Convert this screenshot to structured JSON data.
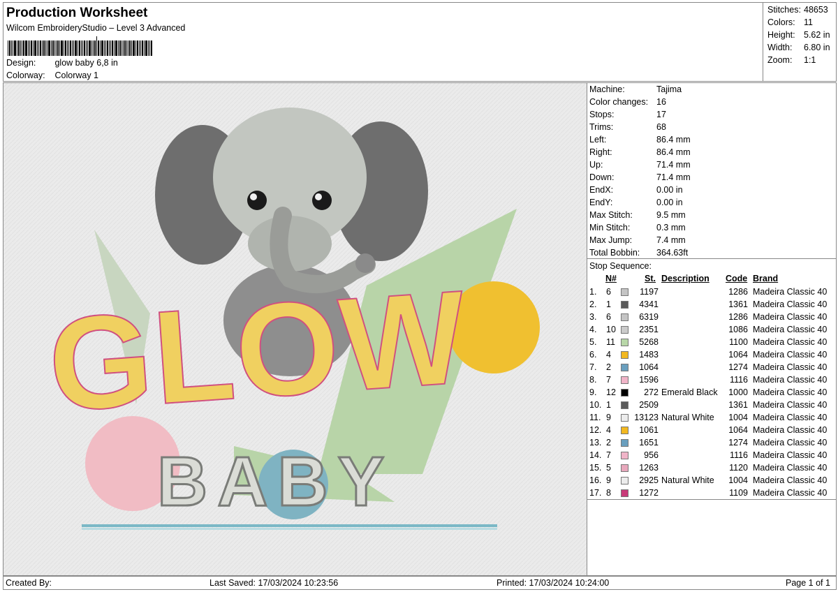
{
  "header": {
    "title": "Production Worksheet",
    "software": "Wilcom EmbroideryStudio – Level 3 Advanced",
    "design_label": "Design:",
    "design_value": "glow baby 6,8 in",
    "colorway_label": "Colorway:",
    "colorway_value": "Colorway 1"
  },
  "stats": {
    "stitches_label": "Stitches:",
    "stitches": "48653",
    "colors_label": "Colors:",
    "colors": "11",
    "height_label": "Height:",
    "height": "5.62 in",
    "width_label": "Width:",
    "width": "6.80 in",
    "zoom_label": "Zoom:",
    "zoom": "1:1"
  },
  "design": {
    "word1": "GLOW",
    "word2": "BABY"
  },
  "machine": [
    {
      "k": "Machine:",
      "v": "Tajima"
    },
    {
      "k": "Color changes:",
      "v": "16"
    },
    {
      "k": "Stops:",
      "v": "17"
    },
    {
      "k": "Trims:",
      "v": "68"
    },
    {
      "k": "Left:",
      "v": "86.4 mm"
    },
    {
      "k": "Right:",
      "v": "86.4 mm"
    },
    {
      "k": "Up:",
      "v": "71.4 mm"
    },
    {
      "k": "Down:",
      "v": "71.4 mm"
    },
    {
      "k": "EndX:",
      "v": "0.00 in"
    },
    {
      "k": "EndY:",
      "v": "0.00 in"
    },
    {
      "k": "Max Stitch:",
      "v": "9.5 mm"
    },
    {
      "k": "Min Stitch:",
      "v": "0.3 mm"
    },
    {
      "k": "Max Jump:",
      "v": "7.4 mm"
    },
    {
      "k": "Total Bobbin:",
      "v": "364.63ft"
    }
  ],
  "sequence": {
    "title": "Stop Sequence:",
    "headers": {
      "n": "N#",
      "st": "St.",
      "desc": "Description",
      "code": "Code",
      "brand": "Brand"
    },
    "rows": [
      {
        "idx": "1.",
        "n": "6",
        "color": "#c4c4c4",
        "st": "1197",
        "desc": "",
        "code": "1286",
        "brand": "Madeira Classic 40"
      },
      {
        "idx": "2.",
        "n": "1",
        "color": "#5a5a5a",
        "st": "4341",
        "desc": "",
        "code": "1361",
        "brand": "Madeira Classic 40"
      },
      {
        "idx": "3.",
        "n": "6",
        "color": "#c4c4c4",
        "st": "6319",
        "desc": "",
        "code": "1286",
        "brand": "Madeira Classic 40"
      },
      {
        "idx": "4.",
        "n": "10",
        "color": "#cbcbcb",
        "st": "2351",
        "desc": "",
        "code": "1086",
        "brand": "Madeira Classic 40"
      },
      {
        "idx": "5.",
        "n": "11",
        "color": "#b8d7a8",
        "st": "5268",
        "desc": "",
        "code": "1100",
        "brand": "Madeira Classic 40"
      },
      {
        "idx": "6.",
        "n": "4",
        "color": "#f2b820",
        "st": "1483",
        "desc": "",
        "code": "1064",
        "brand": "Madeira Classic 40"
      },
      {
        "idx": "7.",
        "n": "2",
        "color": "#6a9fbe",
        "st": "1064",
        "desc": "",
        "code": "1274",
        "brand": "Madeira Classic 40"
      },
      {
        "idx": "8.",
        "n": "7",
        "color": "#f0b4c8",
        "st": "1596",
        "desc": "",
        "code": "1116",
        "brand": "Madeira Classic 40"
      },
      {
        "idx": "9.",
        "n": "12",
        "color": "#000000",
        "st": "272",
        "desc": "Emerald Black",
        "code": "1000",
        "brand": "Madeira Classic 40"
      },
      {
        "idx": "10.",
        "n": "1",
        "color": "#5a5a5a",
        "st": "2509",
        "desc": "",
        "code": "1361",
        "brand": "Madeira Classic 40"
      },
      {
        "idx": "11.",
        "n": "9",
        "color": "#ececec",
        "st": "13123",
        "desc": "Natural White",
        "code": "1004",
        "brand": "Madeira Classic 40"
      },
      {
        "idx": "12.",
        "n": "4",
        "color": "#f2b820",
        "st": "1061",
        "desc": "",
        "code": "1064",
        "brand": "Madeira Classic 40"
      },
      {
        "idx": "13.",
        "n": "2",
        "color": "#6a9fbe",
        "st": "1651",
        "desc": "",
        "code": "1274",
        "brand": "Madeira Classic 40"
      },
      {
        "idx": "14.",
        "n": "7",
        "color": "#f0b4c8",
        "st": "956",
        "desc": "",
        "code": "1116",
        "brand": "Madeira Classic 40"
      },
      {
        "idx": "15.",
        "n": "5",
        "color": "#e8a8bc",
        "st": "1263",
        "desc": "",
        "code": "1120",
        "brand": "Madeira Classic 40"
      },
      {
        "idx": "16.",
        "n": "9",
        "color": "#ececec",
        "st": "2925",
        "desc": "Natural White",
        "code": "1004",
        "brand": "Madeira Classic 40"
      },
      {
        "idx": "17.",
        "n": "8",
        "color": "#c83a78",
        "st": "1272",
        "desc": "",
        "code": "1109",
        "brand": "Madeira Classic 40"
      }
    ]
  },
  "footer": {
    "created_by": "Created By:",
    "last_saved": "Last Saved: 17/03/2024 10:23:56",
    "printed": "Printed: 17/03/2024 10:24:00",
    "page": "Page 1 of 1"
  }
}
